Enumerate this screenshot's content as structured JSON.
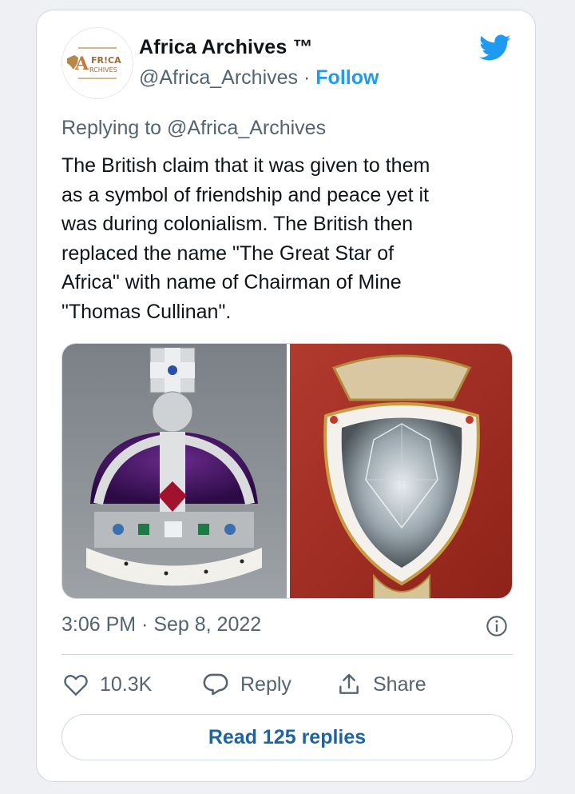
{
  "tweet": {
    "author": {
      "display_name": "Africa Archives ™",
      "handle": "@Africa_Archives",
      "separator": " · ",
      "follow_label": "Follow",
      "avatar_logo_text_top": "FR!CA",
      "avatar_logo_text_bottom": "RCHIVES",
      "avatar_logo_letter": "A"
    },
    "replying_prefix": "Replying to ",
    "replying_handle": "@Africa_Archives",
    "text": "The British claim that it was given to them\nas a symbol of friendship and peace yet it\nwas during colonialism. The British then\nreplaced the name \"The Great Star of\nAfrica\" with name of Chairman of Mine\n\"Thomas Cullinan\".",
    "timestamp": "3:06 PM · Sep 8, 2022",
    "actions": {
      "likes": "10.3K",
      "reply_label": "Reply",
      "share_label": "Share"
    },
    "read_replies_label": "Read 125 replies"
  },
  "colors": {
    "accent": "#1d9bf0",
    "link_button_text": "#1d64a6",
    "secondary_text": "#536471",
    "border": "#cfd9de"
  },
  "icons": [
    "twitter-bird-icon",
    "info-icon",
    "heart-icon",
    "reply-bubble-icon",
    "share-icon"
  ]
}
